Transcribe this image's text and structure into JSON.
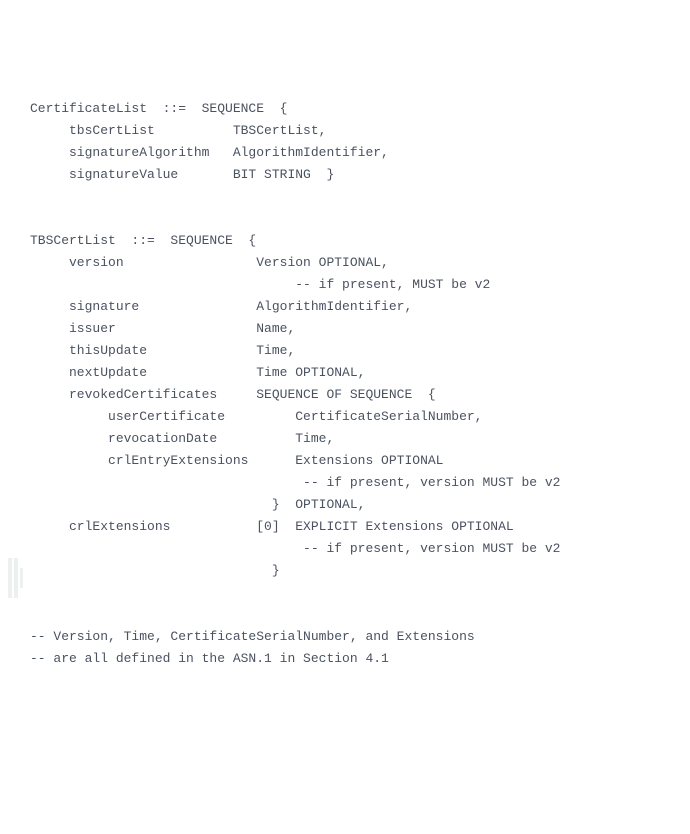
{
  "code": "CertificateList  ::=  SEQUENCE  {\n     tbsCertList          TBSCertList,\n     signatureAlgorithm   AlgorithmIdentifier,\n     signatureValue       BIT STRING  }\n\n\nTBSCertList  ::=  SEQUENCE  {\n     version                 Version OPTIONAL,\n                                  -- if present, MUST be v2\n     signature               AlgorithmIdentifier,\n     issuer                  Name,\n     thisUpdate              Time,\n     nextUpdate              Time OPTIONAL,\n     revokedCertificates     SEQUENCE OF SEQUENCE  {\n          userCertificate         CertificateSerialNumber,\n          revocationDate          Time,\n          crlEntryExtensions      Extensions OPTIONAL\n                                   -- if present, version MUST be v2\n                               }  OPTIONAL,\n     crlExtensions           [0]  EXPLICIT Extensions OPTIONAL\n                                   -- if present, version MUST be v2\n                               }\n\n\n-- Version, Time, CertificateSerialNumber, and Extensions\n-- are all defined in the ASN.1 in Section 4.1"
}
